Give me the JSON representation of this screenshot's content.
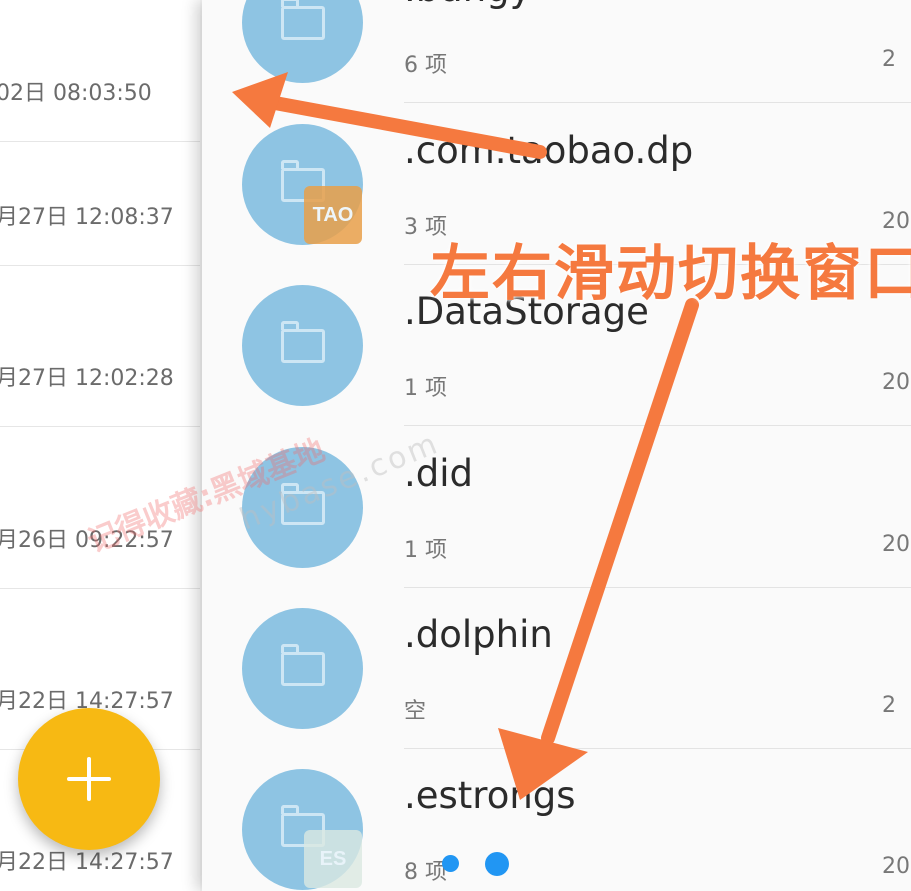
{
  "left_pane": {
    "dates": [
      "02日 08:03:50",
      "月27日 12:08:37",
      "月27日 12:02:28",
      "月26日 09:22:57",
      "月22日 14:27:57",
      "月22日 14:27:57"
    ]
  },
  "folders": [
    {
      "name": ".bungy",
      "count": "6 项",
      "date": "2"
    },
    {
      "name": ".com.taobao.dp",
      "count": "3 项",
      "date": "20"
    },
    {
      "name": ".DataStorage",
      "count": "1 项",
      "date": "20"
    },
    {
      "name": ".did",
      "count": "1 项",
      "date": "20"
    },
    {
      "name": ".dolphin",
      "count": "空",
      "date": "2"
    },
    {
      "name": ".estrongs",
      "count": "8 项",
      "date": "20"
    }
  ],
  "badges": {
    "tao": "TAO",
    "es": "ES"
  },
  "annotation": {
    "text": "左右滑动切换窗口"
  },
  "watermark": {
    "text": "记得收藏:黑域基地",
    "url": "hybase.com"
  },
  "colors": {
    "folder_circle": "#8ec4e3",
    "fab": "#f7b913",
    "arrow": "#f5793f",
    "page_dot": "#2196f3"
  },
  "icons": {
    "folder": "folder-icon",
    "fab": "plus-icon"
  }
}
